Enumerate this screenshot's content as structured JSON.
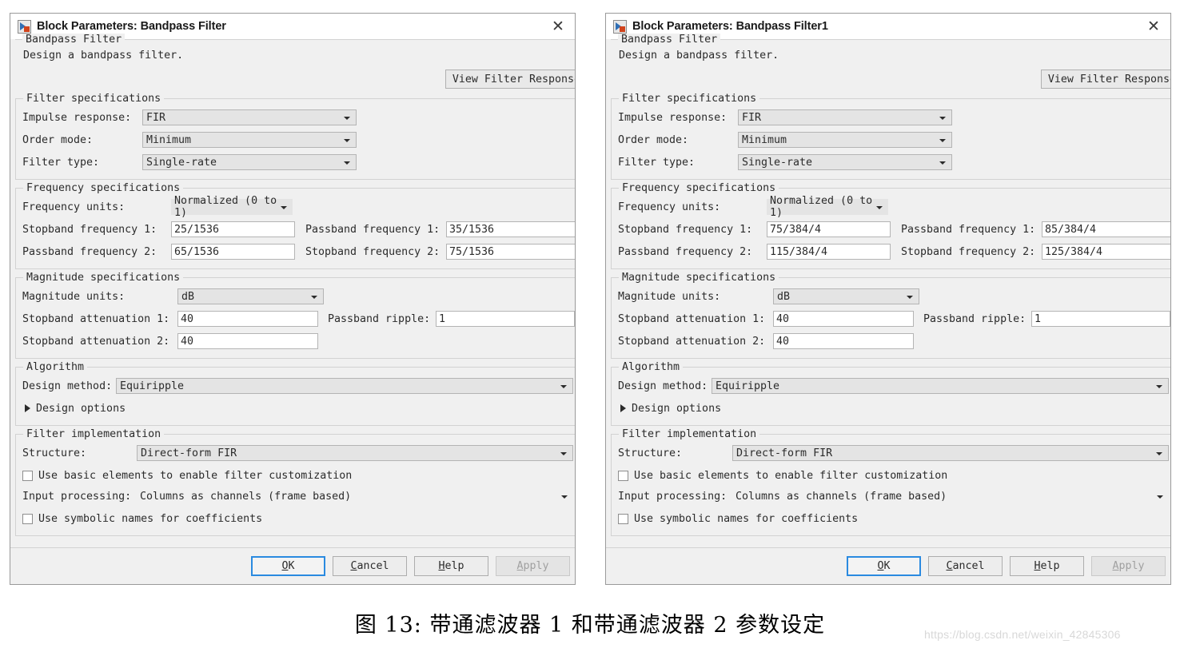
{
  "caption": "图 13: 带通滤波器 1 和带通滤波器 2 参数设定",
  "watermark": "https://blog.csdn.net/weixin_42845306",
  "colors": {
    "dialog_bg": "#f0f0f0",
    "field_bg": "#ffffff",
    "combo_bg": "#e4e4e4",
    "border": "#d2d2d2",
    "default_button_focus": "#2a8ae0",
    "text": "#2b2b2b"
  },
  "common": {
    "header_group_title": "Bandpass Filter",
    "description": "Design a bandpass filter.",
    "view_filter_response": "View Filter Response",
    "filter_specs": {
      "legend": "Filter specifications",
      "impulse_response_label": "Impulse response:",
      "impulse_response_value": "FIR",
      "order_mode_label": "Order mode:",
      "order_mode_value": "Minimum",
      "filter_type_label": "Filter type:",
      "filter_type_value": "Single-rate"
    },
    "frequency_specs": {
      "legend": "Frequency specifications",
      "frequency_units_label": "Frequency units:",
      "frequency_units_value": "Normalized (0 to 1)",
      "stopband_frequency_1_label": "Stopband frequency 1:",
      "passband_frequency_1_label": "Passband frequency 1:",
      "passband_frequency_2_label": "Passband frequency 2:",
      "stopband_frequency_2_label": "Stopband frequency 2:"
    },
    "magnitude_specs": {
      "legend": "Magnitude specifications",
      "magnitude_units_label": "Magnitude units:",
      "magnitude_units_value": "dB",
      "stopband_attenuation_1_label": "Stopband attenuation 1:",
      "stopband_attenuation_1_value": "40",
      "passband_ripple_label": "Passband ripple:",
      "passband_ripple_value": "1",
      "stopband_attenuation_2_label": "Stopband attenuation 2:",
      "stopband_attenuation_2_value": "40"
    },
    "algorithm": {
      "legend": "Algorithm",
      "design_method_label": "Design method:",
      "design_method_value": "Equiripple",
      "design_options_label": "Design options"
    },
    "implementation": {
      "legend": "Filter implementation",
      "structure_label": "Structure:",
      "structure_value": "Direct-form FIR",
      "use_basic_elements_label": "Use basic elements to enable filter customization",
      "use_basic_elements_checked": false,
      "input_processing_label": "Input processing:",
      "input_processing_value": "Columns as channels (frame based)",
      "use_symbolic_names_label": "Use symbolic names for coefficients",
      "use_symbolic_names_checked": false
    },
    "footer": {
      "ok": "OK",
      "ok_mnemonic": "O",
      "cancel": "Cancel",
      "cancel_mnemonic": "C",
      "help": "Help",
      "help_mnemonic": "H",
      "apply": "Apply",
      "apply_mnemonic": "A",
      "apply_enabled": false
    }
  },
  "dialogs": [
    {
      "id": "bandpass-filter",
      "title": "Block Parameters: Bandpass Filter",
      "frequencies": {
        "stopband_frequency_1": "25/1536",
        "passband_frequency_1": "35/1536",
        "passband_frequency_2": "65/1536",
        "stopband_frequency_2": "75/1536"
      }
    },
    {
      "id": "bandpass-filter1",
      "title": "Block Parameters: Bandpass Filter1",
      "frequencies": {
        "stopband_frequency_1": "75/384/4",
        "passband_frequency_1": "85/384/4",
        "passband_frequency_2": "115/384/4",
        "stopband_frequency_2": "125/384/4"
      }
    }
  ]
}
